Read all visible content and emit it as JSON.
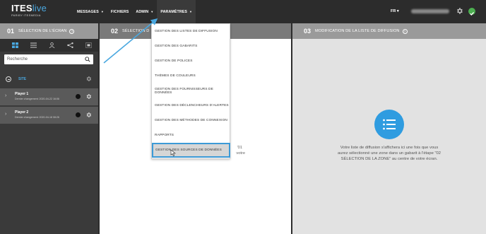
{
  "brand": {
    "name_main": "ITES",
    "name_accent": "live",
    "tagline": "PAR/BY ITESMEDIA"
  },
  "nav": {
    "items": [
      {
        "label": "MESSAGES",
        "caret": true
      },
      {
        "label": "FICHIERS",
        "caret": false
      },
      {
        "label": "ADMIN",
        "caret": true
      },
      {
        "label": "PARAMÈTRES",
        "caret": true
      }
    ],
    "language": "FR ▾"
  },
  "colors": {
    "accent": "#4aa8e0",
    "topbar": "#2c2c2c",
    "highlight_border": "#3d9ad6",
    "status_ok": "#4caf50"
  },
  "left_panel": {
    "number": "01",
    "title": "SÉLECTION DE L'ÉCRAN",
    "help": "?",
    "tools": [
      "grid-view-icon",
      "list-view-icon",
      "user-icon",
      "share-icon",
      "layout-icon"
    ],
    "search_placeholder": "Recherche",
    "site_label": "SITE",
    "players": [
      {
        "name": "Player 1",
        "subtitle": "Dernier changement: 2020-04-22 16:06"
      },
      {
        "name": "Player 2",
        "subtitle": "Dernier changement: 2020-04-18 08:26"
      }
    ]
  },
  "middle_panel": {
    "number": "02",
    "title": "SÉLECTION D",
    "text_line1": "'01",
    "text_line2": "votre",
    "text_line3": "écran."
  },
  "right_panel": {
    "number": "03",
    "title": "MODIFICATION DE LA LISTE DE DIFFUSION",
    "help": "?",
    "message": "Votre liste de diffusion s'affichera ici une fois que vous aurez sélectionné une zone dans un gabarit à l'étape \"02 SÉLECTION DE LA ZONE\" au centre de votre écran."
  },
  "dropdown": {
    "items": [
      "GESTION DES LISTES DE DIFFUSION",
      "GESTION DES GABARITS",
      "GESTION DE POLICES",
      "THÈMES DE COULEURS",
      "GESTION DES FOURNISSEURS DE DONNÉES",
      "GESTION DES DÉCLENCHEURS D'ALERTES",
      "GESTION DES MÉTHODES DE CONNEXION",
      "RAPPORTS",
      "GESTION DES SOURCES DE DONNÉES"
    ],
    "highlighted_index": 8
  }
}
